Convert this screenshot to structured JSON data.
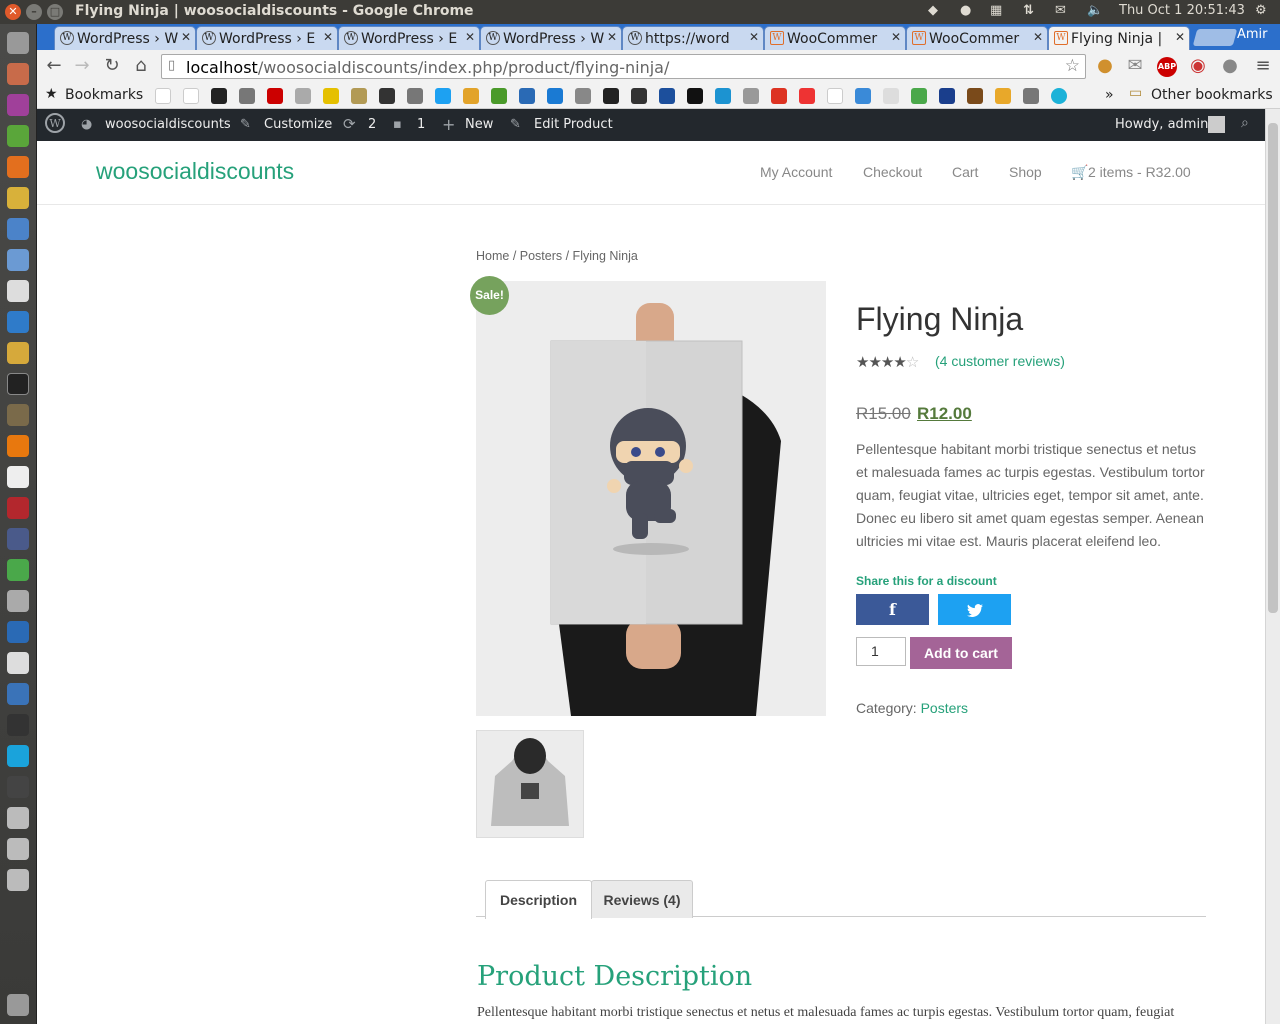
{
  "system": {
    "window_title": "Flying Ninja | woosocialdiscounts - Google Chrome",
    "clock": "Thu Oct  1 20:51:43",
    "user": "Amir"
  },
  "browser": {
    "tabs": [
      {
        "label": "WordPress › W",
        "icon": "wordpress-icon"
      },
      {
        "label": "WordPress › E",
        "icon": "wordpress-icon"
      },
      {
        "label": "WordPress › E",
        "icon": "wordpress-icon"
      },
      {
        "label": "WordPress › W",
        "icon": "wordpress-icon"
      },
      {
        "label": "https://word",
        "icon": "wordpress-icon"
      },
      {
        "label": "WooCommer",
        "icon": "woocommerce-icon"
      },
      {
        "label": "WooCommer",
        "icon": "woocommerce-icon"
      },
      {
        "label": "Flying Ninja | ",
        "icon": "woocommerce-icon",
        "active": true
      }
    ],
    "url_host": "localhost",
    "url_path": "/woosocialdiscounts/index.php/product/flying-ninja/",
    "bookmarks_label": "Bookmarks",
    "other_bookmarks": "Other bookmarks",
    "bookmarks_more": "»"
  },
  "wp_admin_bar": {
    "site_name": "woosocialdiscounts",
    "customize": "Customize",
    "updates_count": "2",
    "comments_count": "1",
    "new": "New",
    "edit_product": "Edit Product",
    "howdy": "Howdy, admin"
  },
  "site": {
    "title": "woosocialdiscounts",
    "menu": [
      "My Account",
      "Checkout",
      "Cart",
      "Shop"
    ],
    "cart_summary": "2 items - R32.00"
  },
  "product": {
    "breadcrumb": "Home / Posters / Flying Ninja",
    "sale_badge": "Sale!",
    "title": "Flying Ninja",
    "rating": 4,
    "rating_max": 5,
    "reviews_link": "(4 customer reviews)",
    "old_price": "R15.00",
    "new_price": "R12.00",
    "short_description": "Pellentesque habitant morbi tristique senectus et netus et malesuada fames ac turpis egestas. Vestibulum tortor quam, feugiat vitae, ultricies eget, tempor sit amet, ante. Donec eu libero sit amet quam egestas semper. Aenean ultricies mi vitae est. Mauris placerat eleifend leo.",
    "share_label": "Share this for a discount",
    "quantity": "1",
    "add_to_cart": "Add to cart",
    "category_label": "Category:",
    "category_value": "Posters",
    "tabs": [
      "Description",
      "Reviews (4)"
    ],
    "desc_heading": "Product Description",
    "desc_text": "Pellentesque habitant morbi tristique senectus et netus et malesuada fames ac turpis egestas. Vestibulum tortor quam, feugiat"
  },
  "colors": {
    "accent": "#26a17a",
    "sale_badge": "#76a25d",
    "add_to_cart": "#a46497",
    "facebook": "#3b5998",
    "twitter": "#1da1f2"
  }
}
